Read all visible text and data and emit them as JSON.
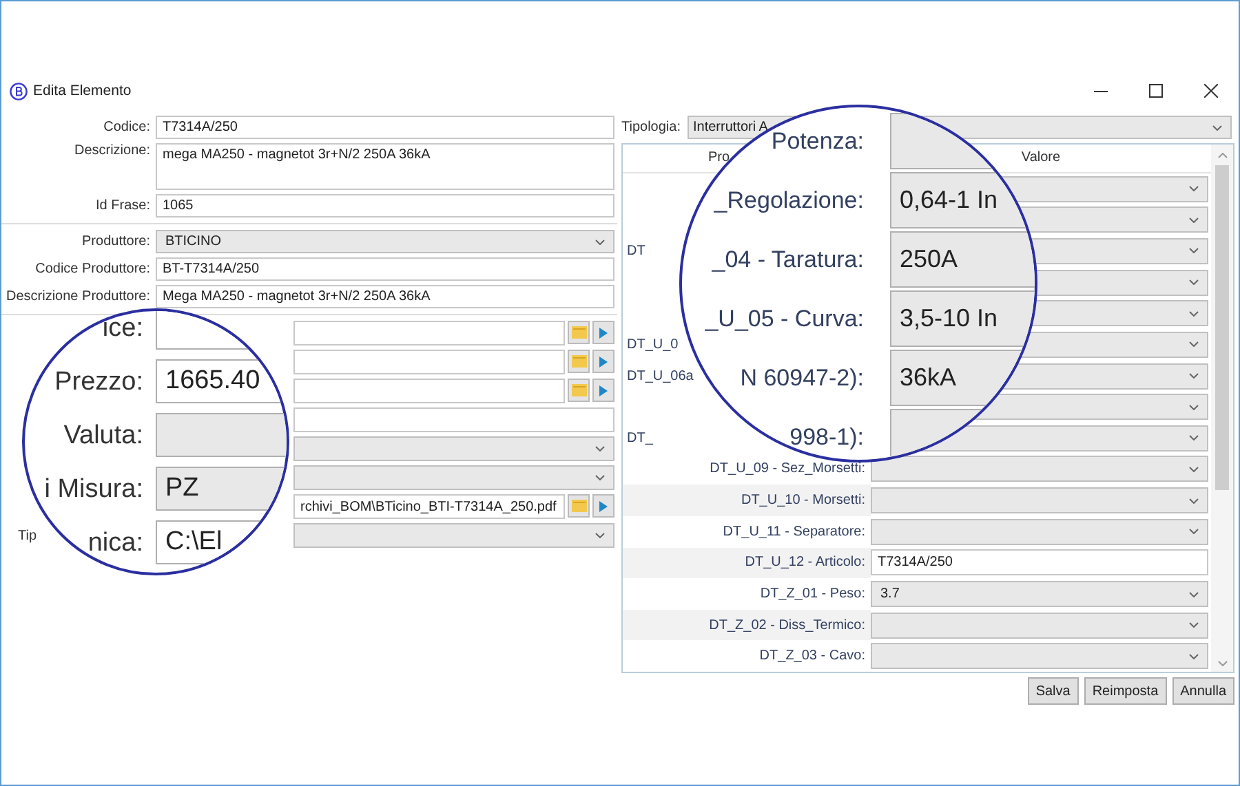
{
  "window": {
    "title": "Edita Elemento"
  },
  "form_top": [
    {
      "label": "Codice:",
      "value": "T7314A/250",
      "kind": "text"
    },
    {
      "label": "Descrizione:",
      "value": "mega MA250 - magnetot 3r+N/2 250A 36kA",
      "kind": "multiline"
    },
    {
      "label": "Id Frase:",
      "value": "1065",
      "kind": "text"
    }
  ],
  "manufacturer": [
    {
      "label": "Produttore:",
      "value": "BTICINO",
      "kind": "combo"
    },
    {
      "label": "Codice Produttore:",
      "value": "BT-T7314A/250",
      "kind": "text"
    },
    {
      "label": "Descrizione Produttore:",
      "value": "Mega MA250 - magnetot 3r+N/2 250A 36kA",
      "kind": "text"
    }
  ],
  "lower_rows": [
    {
      "kind": "file"
    },
    {
      "kind": "file"
    },
    {
      "kind": "file"
    },
    {
      "kind": "text"
    },
    {
      "kind": "combo"
    },
    {
      "kind": "combo"
    },
    {
      "kind": "file",
      "value": "rchivi_BOM\\BTicino_BTI-T7314A_250.pdf"
    },
    {
      "kind": "combo",
      "label": "Tip"
    }
  ],
  "magnifier_left": [
    {
      "label": "ice:",
      "kind": "text"
    },
    {
      "label": "Prezzo:",
      "value": "1665.40",
      "kind": "text"
    },
    {
      "label": "Valuta:",
      "kind": "combo"
    },
    {
      "label": "i Misura:",
      "value": "PZ",
      "kind": "combo"
    },
    {
      "label": "nica:",
      "value": "C:\\El",
      "kind": "text"
    }
  ],
  "tipologia": {
    "label": "Tipologia:",
    "value": "Interruttori A"
  },
  "properties": {
    "columns": [
      "Pro",
      "Valore"
    ],
    "rows": [
      {
        "kind": "combo"
      },
      {
        "kind": "combo"
      },
      {
        "kind": "combo",
        "label": "DT",
        "cut": true
      },
      {
        "kind": "combo"
      },
      {
        "kind": "combo"
      },
      {
        "kind": "combo",
        "label": "DT_U_0",
        "cut": true
      },
      {
        "kind": "combo",
        "label": "DT_U_06a",
        "cut": true
      },
      {
        "kind": "combo"
      },
      {
        "kind": "combo",
        "label": "DT_",
        "cut": true
      },
      {
        "kind": "combo",
        "label": "DT_U_09 - Sez_Morsetti:",
        "cut": false
      },
      {
        "kind": "combo",
        "label": "DT_U_10 - Morsetti:",
        "cut": false
      },
      {
        "kind": "combo",
        "label": "DT_U_11 - Separatore:",
        "cut": false
      },
      {
        "kind": "text",
        "label": "DT_U_12 - Articolo:",
        "value": "T7314A/250",
        "cut": false
      },
      {
        "kind": "combo",
        "label": "DT_Z_01 - Peso:",
        "value": "3.7",
        "cut": false
      },
      {
        "kind": "combo",
        "label": "DT_Z_02 - Diss_Termico:",
        "cut": false
      },
      {
        "kind": "combo",
        "label": "DT_Z_03 - Cavo:",
        "cut": false
      }
    ]
  },
  "magnifier_right": [
    {
      "label": "Potenza:",
      "kind": "combo"
    },
    {
      "label": "_Regolazione:",
      "value": "0,64-1 In",
      "kind": "combo"
    },
    {
      "label": "_04 - Taratura:",
      "value": "250A",
      "kind": "combo"
    },
    {
      "label": "_U_05 - Curva:",
      "value": "3,5-10 In",
      "kind": "combo"
    },
    {
      "label": "N 60947-2):",
      "value": "36kA",
      "kind": "combo"
    },
    {
      "label": "998-1):",
      "kind": "combo"
    }
  ],
  "buttons": [
    "Salva",
    "Reimposta",
    "Annulla"
  ]
}
